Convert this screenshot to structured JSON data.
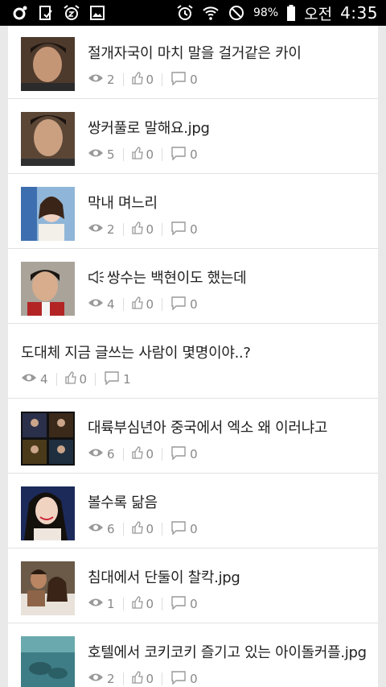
{
  "status_bar": {
    "battery_percent": "98%",
    "ampm": "오전",
    "time": "4:35",
    "left_icons": [
      "record-icon",
      "clipboard-check-icon",
      "alarm-snooze-icon",
      "image-icon"
    ],
    "right_icons": [
      "alarm-icon",
      "wifi-icon",
      "no-disturb-icon",
      "battery-icon"
    ]
  },
  "feed": {
    "items": [
      {
        "title": "절개자국이 마치 말을 걸거같은 카이",
        "views": "2",
        "likes": "0",
        "comments": "0",
        "has_thumb": true,
        "has_speaker": false
      },
      {
        "title": "쌍커풀로 말해요.jpg",
        "views": "5",
        "likes": "0",
        "comments": "0",
        "has_thumb": true,
        "has_speaker": false
      },
      {
        "title": "막내 며느리",
        "views": "2",
        "likes": "0",
        "comments": "0",
        "has_thumb": true,
        "has_speaker": false
      },
      {
        "title": "쌍수는 백현이도 했는데",
        "views": "4",
        "likes": "0",
        "comments": "0",
        "has_thumb": true,
        "has_speaker": true
      },
      {
        "title": "도대체 지금 글쓰는 사람이 몇명이야..?",
        "views": "4",
        "likes": "0",
        "comments": "1",
        "has_thumb": false,
        "has_speaker": false
      },
      {
        "title": "대륙부심년아 중국에서 엑소 왜 이러냐고",
        "views": "6",
        "likes": "0",
        "comments": "0",
        "has_thumb": true,
        "has_speaker": false
      },
      {
        "title": "볼수록 닮음",
        "views": "6",
        "likes": "0",
        "comments": "0",
        "has_thumb": true,
        "has_speaker": false
      },
      {
        "title": "침대에서 단둘이 찰칵.jpg",
        "views": "1",
        "likes": "0",
        "comments": "0",
        "has_thumb": true,
        "has_speaker": false
      },
      {
        "title": "호텔에서 코키코키 즐기고 있는 아이돌커플.jpg",
        "views": "2",
        "likes": "0",
        "comments": "0",
        "has_thumb": true,
        "has_speaker": false
      }
    ]
  },
  "colors": {
    "statusbar_bg": "#000000",
    "page_bg": "#e9e9e9",
    "card_bg": "#ffffff",
    "meta_text": "#888888",
    "title_text": "#222222"
  }
}
